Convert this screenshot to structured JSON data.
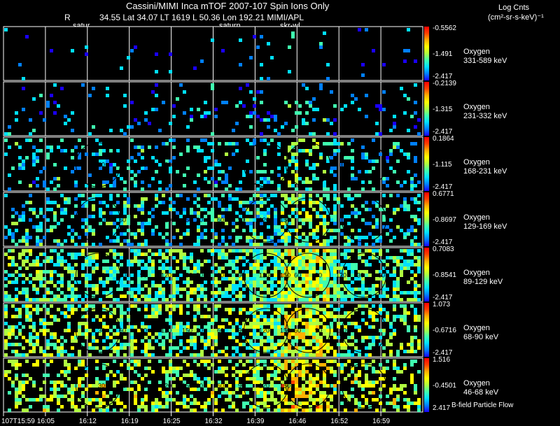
{
  "header": {
    "title": "Cassini/MIMI Inca mTOF  2007-107   Spin    Ions Only",
    "r_label": "R",
    "position_line": "34.55 Lat 34.07 LT 1619 L          50.36 Lon          192.21   MIMI/APL",
    "marker_1": "satur",
    "marker_2": "saturn",
    "marker_3": "skr-wl",
    "units_title": "Log Cnts",
    "units_label": "(cm²-sr-s-keV)⁻¹"
  },
  "footer": {
    "b_field_note": "B-field Particle Flow"
  },
  "colors": {
    "colormap": [
      "#1a00ff",
      "#0080ff",
      "#00e0ff",
      "#40ffb0",
      "#b0ff40",
      "#ffff00",
      "#ffb000",
      "#ff4000",
      "#ff0000"
    ]
  },
  "chart_data": {
    "type": "heatmap",
    "x_tick_labels": [
      "107T15:59",
      "16:05",
      "16:12",
      "16:19",
      "16:25",
      "16:32",
      "16:39",
      "16:46",
      "16:52",
      "16:59"
    ],
    "panel_columns": 10,
    "panels": [
      {
        "species": "Oxygen",
        "energy": "331-589 keV",
        "cb_max": "-0.5562",
        "cb_mid": "-1.491",
        "cb_min": "-2.417",
        "level": 0.15,
        "density": 0.02,
        "dial_labels": []
      },
      {
        "species": "Oxygen",
        "energy": "231-332 keV",
        "cb_max": "-0.2139",
        "cb_mid": "-1.315",
        "cb_min": "-2.417",
        "level": 0.2,
        "density": 0.08,
        "dial_labels": []
      },
      {
        "species": "Oxygen",
        "energy": "168-231 keV",
        "cb_max": "0.1864",
        "cb_mid": "-1.115",
        "cb_min": "-2.417",
        "level": 0.28,
        "density": 0.2,
        "dial_labels": [
          "30",
          "60",
          "90",
          "120"
        ]
      },
      {
        "species": "Oxygen",
        "energy": "129-169 keV",
        "cb_max": "0.6771",
        "cb_mid": "-0.8697",
        "cb_min": "-2.417",
        "level": 0.32,
        "density": 0.32,
        "dial_labels": [
          "30",
          "60",
          "90",
          "120",
          "150",
          "30",
          "60",
          "90",
          "120",
          "150"
        ]
      },
      {
        "species": "Oxygen",
        "energy": "89-129 keV",
        "cb_max": "0.7083",
        "cb_mid": "-0.8541",
        "cb_min": "-2.417",
        "level": 0.4,
        "density": 0.5,
        "dial_labels": [
          "30",
          "60",
          "90",
          "120",
          "150",
          "30",
          "60",
          "90",
          "120",
          "150",
          "60",
          "90",
          "120",
          "30",
          "60"
        ]
      },
      {
        "species": "Oxygen",
        "energy": "68-90 keV",
        "cb_max": "1.073",
        "cb_mid": "-0.6716",
        "cb_min": "-2.417",
        "level": 0.45,
        "density": 0.42,
        "dial_labels": [
          "30",
          "60",
          "90",
          "120",
          "150",
          "30",
          "60",
          "90",
          "120",
          "150",
          "60",
          "90",
          "120"
        ]
      },
      {
        "species": "Oxygen",
        "energy": "46-68 keV",
        "cb_max": "1.516",
        "cb_mid": "-0.4501",
        "cb_min": "2.417",
        "level": 0.5,
        "density": 0.38,
        "dial_labels": [
          "30",
          "60",
          "90",
          "120",
          "150",
          "30",
          "60",
          "90",
          "120",
          "150"
        ]
      }
    ]
  }
}
